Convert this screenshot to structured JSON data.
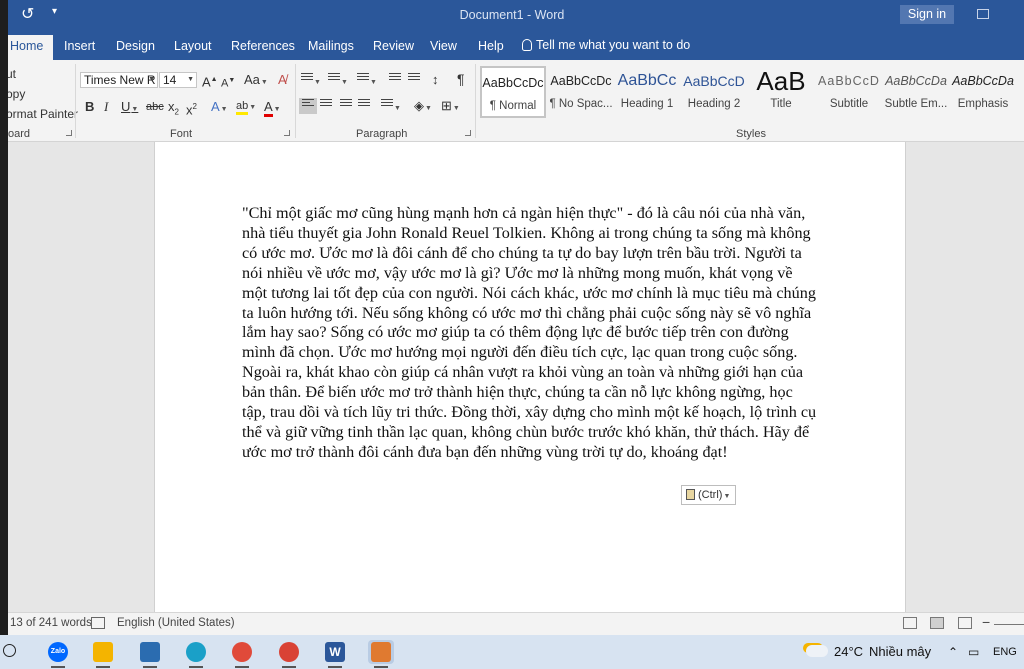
{
  "window": {
    "title": "Document1  -  Word",
    "sign_in": "Sign in"
  },
  "tabs": [
    "Home",
    "Insert",
    "Design",
    "Layout",
    "References",
    "Mailings",
    "Review",
    "View",
    "Help"
  ],
  "tell_me": "Tell me what you want to do",
  "clipboard": {
    "items": [
      "ut",
      "opy",
      "ormat Painter"
    ],
    "label": "oard"
  },
  "font": {
    "name": "Times New R",
    "size": "14",
    "grow": "A",
    "shrink": "A",
    "case": "Aa",
    "bold": "B",
    "italic": "I",
    "underline": "U",
    "strike": "abc",
    "subscript": "x",
    "superscript": "x",
    "label": "Font"
  },
  "paragraph": {
    "pilcrow": "¶",
    "label": "Paragraph"
  },
  "styles": {
    "label": "Styles",
    "items": [
      {
        "preview": "AaBbCcDc",
        "name": "¶ Normal"
      },
      {
        "preview": "AaBbCcDc",
        "name": "¶ No Spac..."
      },
      {
        "preview": "AaBbCc",
        "name": "Heading 1"
      },
      {
        "preview": "AaBbCcD",
        "name": "Heading 2"
      },
      {
        "preview": "AaB",
        "name": "Title"
      },
      {
        "preview": "AaBbCcD",
        "name": "Subtitle"
      },
      {
        "preview": "AaBbCcDa",
        "name": "Subtle Em..."
      },
      {
        "preview": "AaBbCcDa",
        "name": "Emphasis"
      }
    ]
  },
  "document": {
    "text": "\"Chỉ một giấc mơ cũng hùng mạnh hơn cả ngàn hiện thực\" - đó là câu nói của nhà văn, nhà tiểu thuyết gia John Ronald Reuel Tolkien. Không ai trong chúng ta sống mà không có ước mơ. Ước mơ là đôi cánh để cho chúng ta tự do bay lượn trên bầu trời. Người ta nói nhiều về ước mơ, vậy ước mơ là gì? Ước mơ là những mong muốn, khát vọng về một tương lai tốt đẹp của con người. Nói cách khác, ước mơ chính là mục tiêu mà chúng ta luôn hướng tới. Nếu sống không có ước mơ thì chẳng phải cuộc sống này sẽ vô nghĩa lắm hay sao? Sống có ước mơ giúp ta có thêm động lực để bước tiếp trên con đường mình đã chọn. Ước mơ hướng mọi người đến điều tích cực, lạc quan trong cuộc sống. Ngoài ra, khát khao còn giúp cá nhân vượt ra khỏi vùng an toàn và những giới hạn của bản thân. Để biến ước mơ trở thành hiện thực, chúng ta cần nỗ lực không ngừng, học tập, trau dồi và tích lũy tri thức. Đồng thời, xây dựng cho mình một kế hoạch, lộ trình cụ thể và giữ vững tinh thần lạc quan, không chùn bước trước khó khăn, thử thách. Hãy để ước mơ trở thành đôi cánh đưa bạn đến những vùng trời tự do, khoáng đạt!",
    "paste_options": "(Ctrl)"
  },
  "status": {
    "word_count": "13 of 241 words",
    "language": "English (United States)"
  },
  "taskbar": {
    "apps": [
      {
        "name": "zalo",
        "label": "Zalo",
        "color": "#0068ff"
      },
      {
        "name": "file-explorer",
        "label": "",
        "color": "#f4b400"
      },
      {
        "name": "microsoft-store",
        "label": "",
        "color": "#2b6cb0"
      },
      {
        "name": "edge",
        "label": "",
        "color": "#1aa0c8"
      },
      {
        "name": "chrome",
        "label": "",
        "color": "#e04a3a"
      },
      {
        "name": "chrome-profile",
        "label": "",
        "color": "#d94235"
      },
      {
        "name": "word",
        "label": "W",
        "color": "#2b579a"
      },
      {
        "name": "paint-app",
        "label": "",
        "color": "#e07a30"
      }
    ],
    "weather_temp": "24°C",
    "weather_desc": "Nhiều mây",
    "lang": "ENG"
  },
  "colors": {
    "accent": "#2b579a",
    "ribbon": "#f3f3f3",
    "canvas": "#e6e6e6"
  }
}
